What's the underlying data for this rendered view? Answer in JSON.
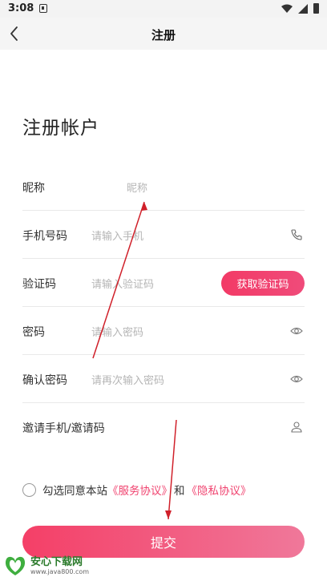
{
  "status_bar": {
    "time": "3:08"
  },
  "nav": {
    "title": "注册"
  },
  "page_title": "注册帐户",
  "form": {
    "nickname": {
      "label": "昵称",
      "placeholder": "昵称"
    },
    "phone": {
      "label": "手机号码",
      "placeholder": "请输入手机"
    },
    "code": {
      "label": "验证码",
      "placeholder": "请输入验证码",
      "button": "获取验证码"
    },
    "password": {
      "label": "密码",
      "placeholder": "请输入密码"
    },
    "confirm_password": {
      "label": "确认密码",
      "placeholder": "请再次输入密码"
    },
    "invite": {
      "label": "邀请手机/邀请码",
      "placeholder": ""
    }
  },
  "agreement": {
    "prefix": "勾选同意本站",
    "service_link": "《服务协议》",
    "and": "和",
    "privacy_link": "《隐私协议》"
  },
  "submit": "提交",
  "watermark": {
    "name": "安心下载网",
    "url": "www.java800.com"
  },
  "colors": {
    "accent": "#f23a66",
    "link": "#f0436f",
    "annotation": "#d0202a"
  },
  "icons": [
    "back-arrow-icon",
    "phone-icon",
    "eye-icon",
    "person-icon"
  ]
}
